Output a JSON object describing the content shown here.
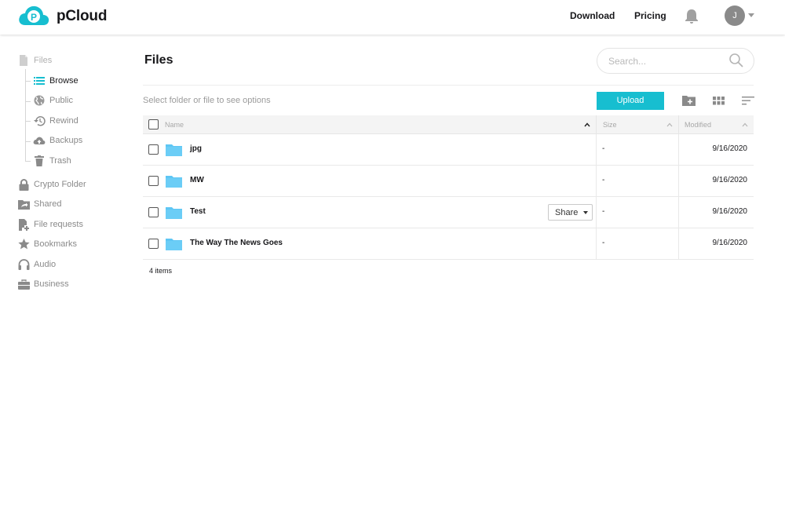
{
  "header": {
    "brand": "pCloud",
    "nav": {
      "download": "Download",
      "pricing": "Pricing"
    },
    "avatar_initial": "J",
    "brand_color": "#17bed0"
  },
  "sidebar": {
    "files": {
      "label": "Files",
      "icon": "file-icon"
    },
    "sub_items": [
      {
        "label": "Browse",
        "icon": "list-icon",
        "active": true
      },
      {
        "label": "Public",
        "icon": "globe-icon"
      },
      {
        "label": "Rewind",
        "icon": "history-icon"
      },
      {
        "label": "Backups",
        "icon": "cloud-upload-icon"
      },
      {
        "label": "Trash",
        "icon": "trash-icon"
      }
    ],
    "items": [
      {
        "label": "Crypto Folder",
        "icon": "lock-icon"
      },
      {
        "label": "Shared",
        "icon": "shared-folder-icon"
      },
      {
        "label": "File requests",
        "icon": "file-request-icon"
      },
      {
        "label": "Bookmarks",
        "icon": "star-icon"
      },
      {
        "label": "Audio",
        "icon": "headphones-icon"
      },
      {
        "label": "Business",
        "icon": "briefcase-icon"
      }
    ]
  },
  "main": {
    "title": "Files",
    "search_placeholder": "Search...",
    "hint": "Select folder or file to see options",
    "upload_label": "Upload",
    "columns": {
      "name": "Name",
      "size": "Size",
      "modified": "Modified"
    },
    "rows": [
      {
        "name": "jpg",
        "size": "-",
        "modified": "9/16/2020"
      },
      {
        "name": "MW",
        "size": "-",
        "modified": "9/16/2020"
      },
      {
        "name": "Test",
        "size": "-",
        "modified": "9/16/2020",
        "share": "Share"
      },
      {
        "name": "The Way The News Goes",
        "size": "-",
        "modified": "9/16/2020"
      }
    ],
    "count": "4 items"
  }
}
